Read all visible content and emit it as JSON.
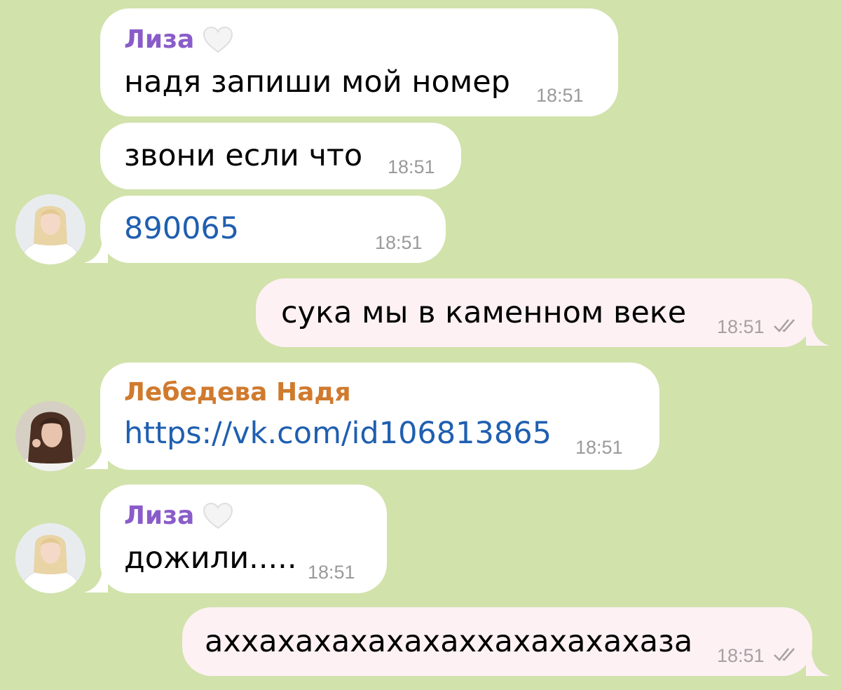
{
  "colors": {
    "background": "#d1e2ab",
    "incoming_bubble": "#ffffff",
    "outgoing_bubble": "#fdf1f4",
    "liza_name": "#8a5cc9",
    "nadya_name": "#d07a2e",
    "link": "#1f5fb0",
    "timestamp": "#9a9a9a"
  },
  "messages": [
    {
      "sender": "Лиза",
      "sender_icon": "white-heart-icon",
      "text": "надя запиши мой номер",
      "time": "18:51"
    },
    {
      "text": "звони если что",
      "time": "18:51"
    },
    {
      "text": "890065",
      "time": "18:51",
      "is_link": true,
      "partially_redacted": true
    },
    {
      "text": "сука мы в каменном веке",
      "time": "18:51",
      "outgoing": true,
      "read_icon": "double-check-icon"
    },
    {
      "sender": "Лебедева Надя",
      "text": "https://vk.com/id106813865",
      "time": "18:51",
      "is_link": true
    },
    {
      "sender": "Лиза",
      "sender_icon": "white-heart-icon",
      "text": "дожили.....",
      "time": "18:51"
    },
    {
      "text": "аххахахахахахаххахахахахаза",
      "time": "18:51",
      "outgoing": true,
      "read_icon": "double-check-icon"
    }
  ]
}
